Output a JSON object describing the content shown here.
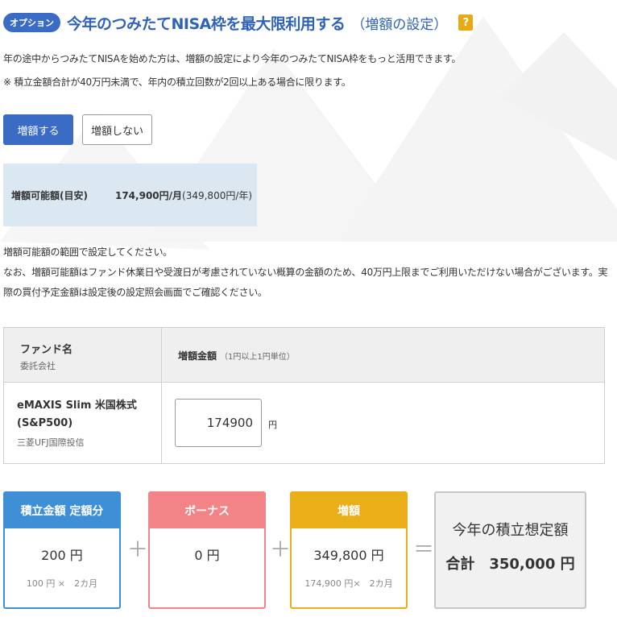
{
  "header": {
    "badge": "オプション",
    "title": "今年のつみたてNISA枠を最大限利用する",
    "subtitle": "（増額の設定）",
    "help": "?"
  },
  "description": {
    "line1": "年の途中からつみたてNISAを始めた方は、増額の設定により今年のつみたてNISA枠をもっと活用できます。",
    "line2": "※ 積立金額合計が40万円未満で、年内の積立回数が2回以上ある場合に限ります。"
  },
  "toggle": {
    "increase_label": "増額する",
    "no_increase_label": "増額しない",
    "selected": "増額する"
  },
  "available": {
    "label": "増額可能額(目安)",
    "value": "174,900円/月",
    "paren": "(349,800円/年)"
  },
  "notes": {
    "line1": "増額可能額の範囲で設定してください。",
    "line2": "なお、増額可能額はファンド休業日や受渡日が考慮されていない概算の金額のため、40万円上限までご利用いただけない場合がございます。実際の買付予定金額は設定後の設定照会画面でご確認ください。"
  },
  "table": {
    "col_fund": "ファンド名",
    "col_fund_sub": "委託会社",
    "col_amount": "増額金額",
    "col_amount_sub": "（1円以上1円単位）",
    "fund_name": "eMAXIS Slim 米国株式(S&P500)",
    "company": "三菱UFJ国際投信",
    "amount_value": "174900",
    "unit": "円"
  },
  "summary": {
    "regular": {
      "head": "積立金額 定額分",
      "value": "200 円",
      "sub": "100 円 ×　2カ月"
    },
    "bonus": {
      "head": "ボーナス",
      "value": "0 円"
    },
    "increase": {
      "head": "増額",
      "value": "349,800 円",
      "sub": "174,900 円×　2カ月"
    },
    "plus": "＋",
    "equals": "＝",
    "total_label": "今年の積立想定額",
    "total_value": "合計　350,000 円"
  },
  "colors": {
    "accent_blue": "#3a6cc6",
    "regular": "#3e8fd6",
    "bonus": "#f28488",
    "increase": "#e9ae18"
  }
}
